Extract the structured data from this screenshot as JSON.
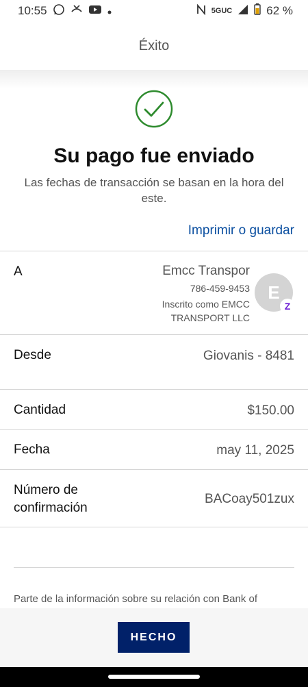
{
  "status_bar": {
    "time": "10:55",
    "network": "5GUC",
    "battery": "62 %"
  },
  "app_bar": {
    "title": "Éxito"
  },
  "success": {
    "headline": "Su pago fue enviado",
    "subtext": "Las fechas de transacción se basan en la hora del este.",
    "print_link": "Imprimir o guardar"
  },
  "details": {
    "to": {
      "label": "A",
      "name": "Emcc Transpor",
      "phone": "786-459-9453",
      "enrolled": "Inscrito como EMCC TRANSPORT LLC",
      "avatar_initial": "E"
    },
    "from": {
      "label": "Desde",
      "value": "Giovanis - 8481"
    },
    "amount": {
      "label": "Cantidad",
      "value": "$150.00"
    },
    "date": {
      "label": "Fecha",
      "value": "may 11, 2025"
    },
    "confirmation": {
      "label": "Número de confirmación",
      "value": "BACoay501zux"
    }
  },
  "footnote": "Parte de la información sobre su relación con Bank of",
  "footer": {
    "done_label": "HECHO"
  },
  "colors": {
    "brand_blue": "#012169",
    "link_blue": "#0b4fa0",
    "success_green": "#2e8b2e",
    "zelle_purple": "#6d1ed4"
  }
}
